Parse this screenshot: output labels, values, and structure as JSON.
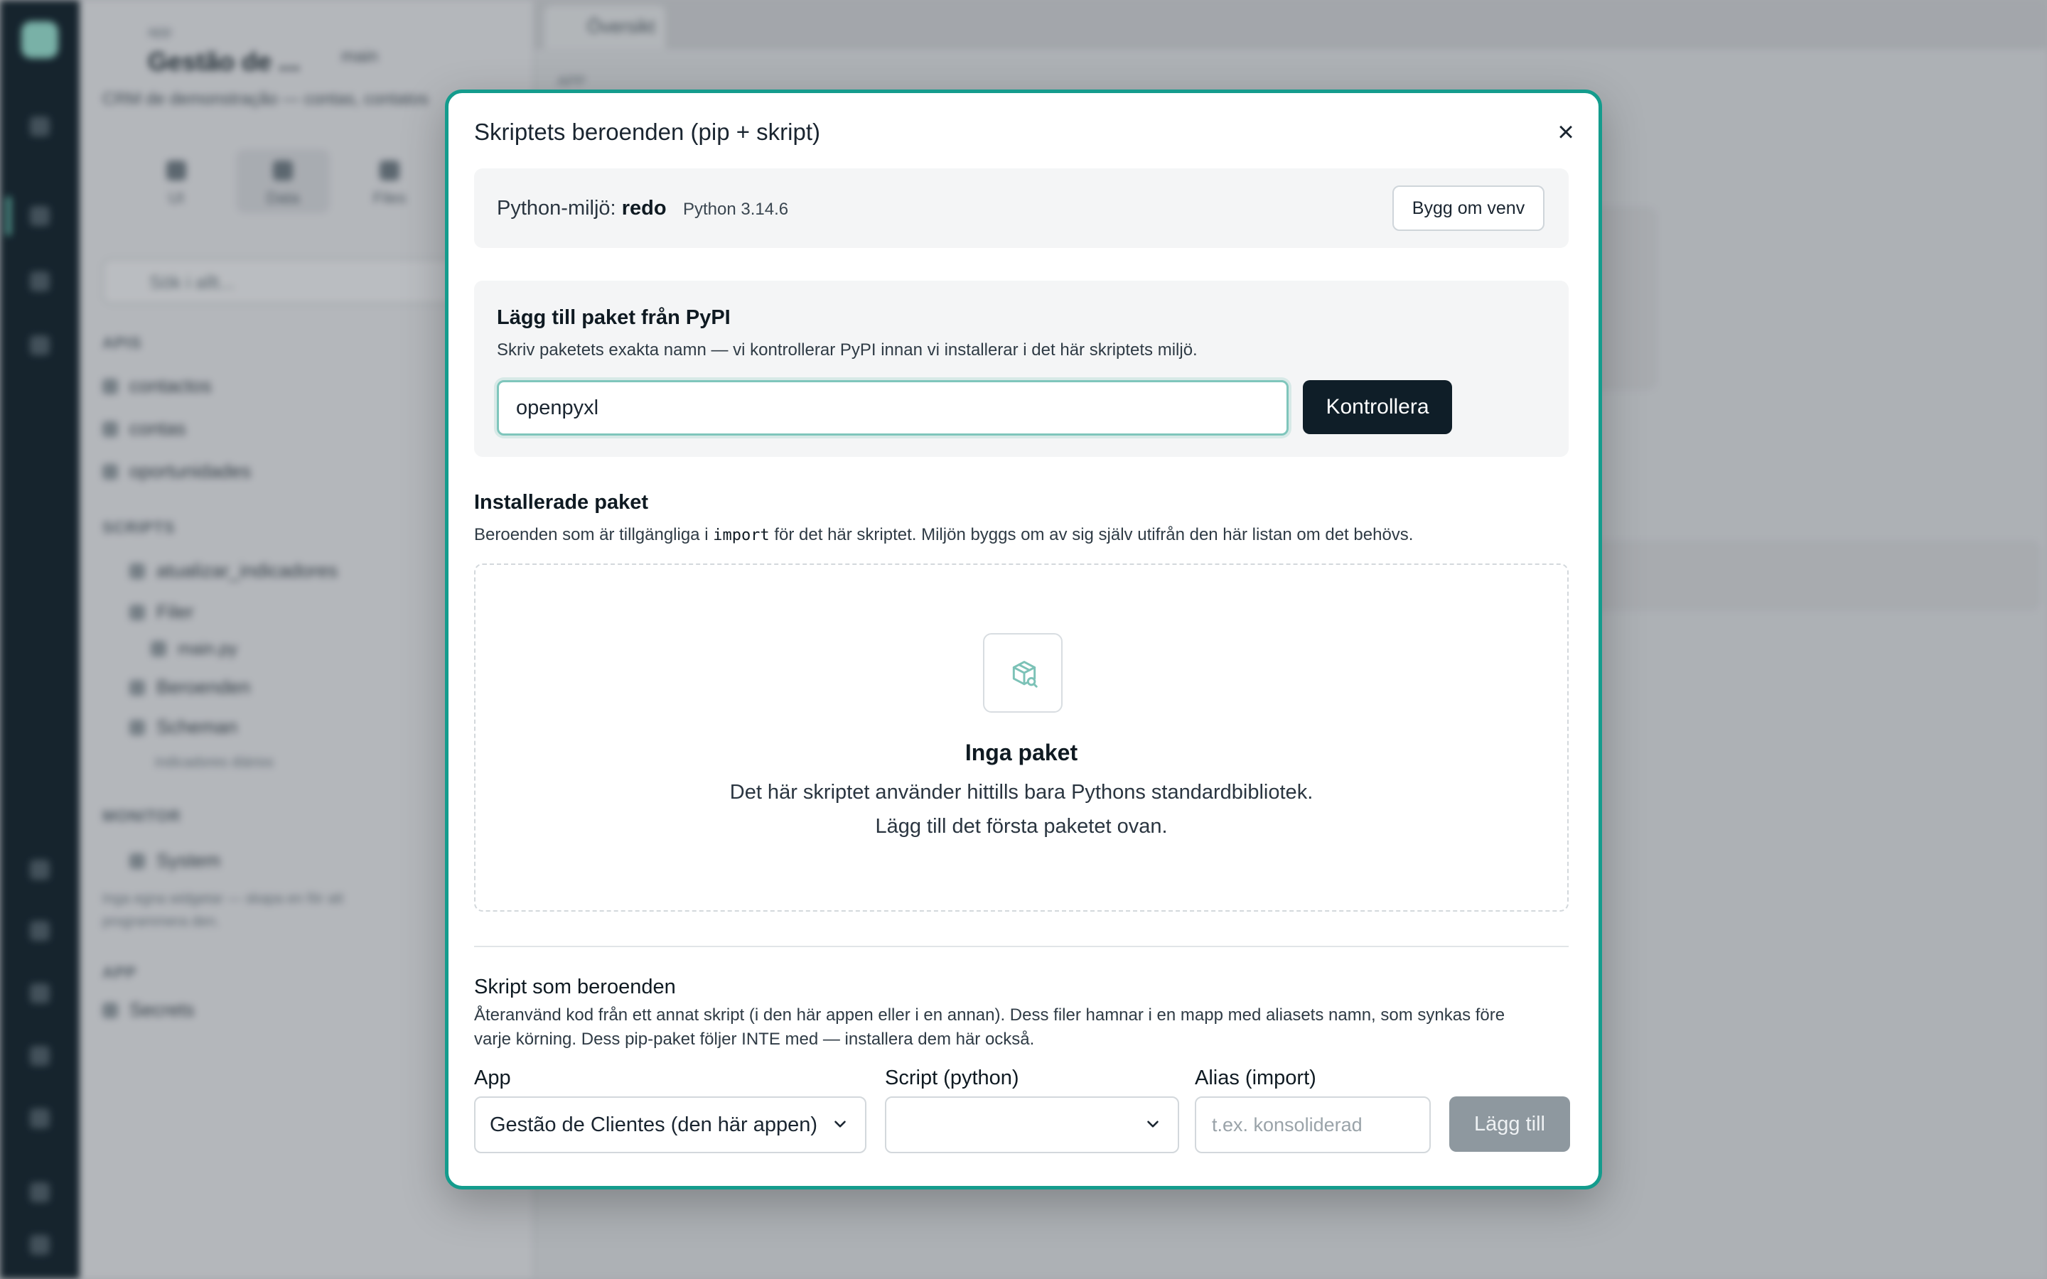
{
  "background": {
    "sidebar": {
      "app_kicker": "app",
      "app_title": "Gestão de ...",
      "branch": "main",
      "description": "CRM de demonstração — contas, contatos",
      "tabs": [
        {
          "label": "UI"
        },
        {
          "label": "Data"
        },
        {
          "label": "Files"
        }
      ],
      "search_placeholder": "Sök i allt...",
      "sections": {
        "apis": "APIS",
        "scripts": "SCRIPTS",
        "monitor": "MONITOR",
        "app": "APP"
      },
      "apis_items": [
        "contactos",
        "contas",
        "oportunidades"
      ],
      "script_items": [
        "atualizar_indicadores",
        "Filer",
        "main.py",
        "Beroenden",
        "Scheman",
        "indicadores diários"
      ],
      "monitor_item": "System",
      "monitor_note_line1": "Inga egna widgetar — skapa en för att",
      "monitor_note_line2": "programmera den.",
      "app_item": "Secrets"
    },
    "main": {
      "tab_label": "Översikt",
      "kicker": "APP"
    }
  },
  "dialog": {
    "title": "Skriptets beroenden (pip + skript)",
    "close_icon": "close-icon",
    "env": {
      "label": "Python-miljö:",
      "state": "redo",
      "version": "Python 3.14.6",
      "rebuild_button": "Bygg om venv"
    },
    "pypi": {
      "heading": "Lägg till paket från PyPI",
      "description": "Skriv paketets exakta namn — vi kontrollerar PyPI innan vi installerar i det här skriptets miljö.",
      "input_value": "openpyxl",
      "check_button": "Kontrollera"
    },
    "installed": {
      "heading": "Installerade paket",
      "desc_before": "Beroenden som är tillgängliga i ",
      "desc_code": "import",
      "desc_after": " för det här skriptet. Miljön byggs om av sig själv utifrån den här listan om det behövs.",
      "empty_icon": "package-search-icon",
      "empty_title": "Inga paket",
      "empty_line1": "Det här skriptet använder hittills bara Pythons standardbibliotek.",
      "empty_line2": "Lägg till det första paketet ovan."
    },
    "script_deps": {
      "heading": "Skript som beroenden",
      "desc_line1": "Återanvänd kod från ett annat skript (i den här appen eller i en annan). Dess filer hamnar i en mapp med aliasets namn, som synkas före",
      "desc_line2": "varje körning. Dess pip-paket följer INTE med — installera dem här också.",
      "app_label": "App",
      "app_value": "Gestão de Clientes (den här appen)",
      "script_label": "Script (python)",
      "script_value": "",
      "alias_label": "Alias (import)",
      "alias_placeholder": "t.ex. konsoliderad",
      "add_button": "Lägg till"
    }
  },
  "colors": {
    "accent_border": "#149c8d",
    "primary_button": "#0f1e28",
    "disabled_button": "#8e989f",
    "rail": "#16262f"
  }
}
